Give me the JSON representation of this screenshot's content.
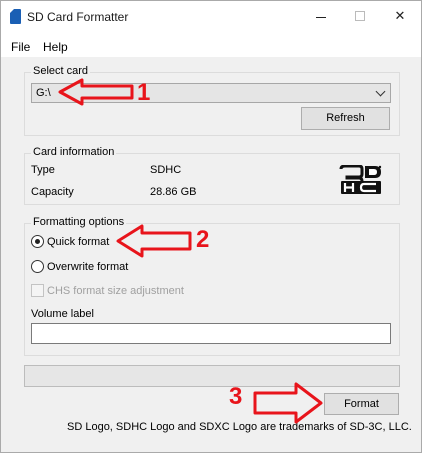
{
  "window": {
    "title": "SD Card Formatter",
    "minimize": "—",
    "close": "✕"
  },
  "menu": {
    "file": "File",
    "help": "Help"
  },
  "select_card": {
    "group_label": "Select card",
    "selected_value": "G:\\",
    "refresh_label": "Refresh"
  },
  "card_info": {
    "group_label": "Card information",
    "type_label": "Type",
    "type_value": "SDHC",
    "capacity_label": "Capacity",
    "capacity_value": "28.86 GB",
    "logo_text": "SDHC"
  },
  "formatting": {
    "group_label": "Formatting options",
    "quick_format": "Quick format",
    "quick_format_checked": true,
    "overwrite_format": "Overwrite format",
    "overwrite_format_checked": false,
    "chs_label": "CHS format size adjustment",
    "chs_checked": false,
    "chs_enabled": false,
    "volume_label": "Volume label",
    "volume_value": ""
  },
  "progress": {
    "value": 0
  },
  "format_button": "Format",
  "footer": "SD Logo, SDHC Logo and SDXC Logo are trademarks of SD-3C, LLC.",
  "annotations": {
    "arrow_color": "#e8141b",
    "numbers": [
      "1",
      "2",
      "3"
    ]
  }
}
